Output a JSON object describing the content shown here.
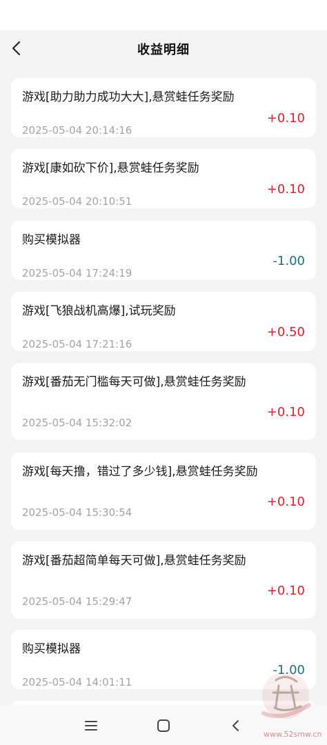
{
  "header": {
    "title": "收益明细",
    "back_icon": "chevron-left-icon"
  },
  "colors": {
    "positive": "#e0202a",
    "negative": "#1f6e80",
    "time": "#a3a3a3",
    "background": "#f3f3f3"
  },
  "records": [
    {
      "title": "游戏[助力助力成功大大],悬赏蛙任务奖励",
      "time": "2025-05-04 20:14:16",
      "amount": "+0.10"
    },
    {
      "title": "游戏[康如砍下价],悬赏蛙任务奖励",
      "time": "2025-05-04 20:10:51",
      "amount": "+0.10"
    },
    {
      "title": "购买模拟器",
      "time": "2025-05-04 17:24:19",
      "amount": "-1.00"
    },
    {
      "title": "游戏[飞狼战机高爆],试玩奖励",
      "time": "2025-05-04 17:21:16",
      "amount": "+0.50"
    },
    {
      "title": "游戏[番茄无门槛每天可做],悬赏蛙任务奖励",
      "time": "2025-05-04 15:32:02",
      "amount": "+0.10"
    },
    {
      "title": "游戏[每天撸，错过了多少钱],悬赏蛙任务奖励",
      "time": "2025-05-04 15:30:54",
      "amount": "+0.10"
    },
    {
      "title": "游戏[番茄超简单每天可做],悬赏蛙任务奖励",
      "time": "2025-05-04 15:29:47",
      "amount": "+0.10"
    },
    {
      "title": "购买模拟器",
      "time": "2025-05-04 14:01:11",
      "amount": "-1.00"
    }
  ],
  "navigation": {
    "menu_icon": "menu-icon",
    "home_icon": "home-square-icon",
    "back_icon": "back-triangle-icon"
  },
  "watermark": {
    "text": "www.52smw.cn",
    "logo": "吾爱首码"
  }
}
